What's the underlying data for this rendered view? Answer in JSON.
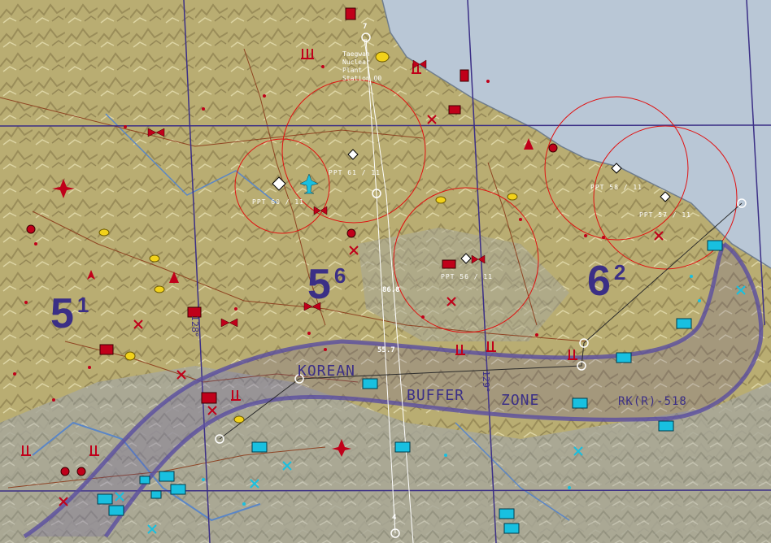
{
  "map": {
    "grid_labels": [
      {
        "main": "5",
        "sup": "1"
      },
      {
        "main": "5",
        "sup": "6"
      },
      {
        "main": "6",
        "sup": "2"
      }
    ],
    "longitude_labels": [
      "128°",
      "129°"
    ],
    "zone": {
      "word1": "KOREAN",
      "word2": "BUFFER",
      "word3": "ZONE",
      "id": "RK(R)-518"
    },
    "ppt_labels": [
      "PPT 60 / 11",
      "PPT 61 / 11",
      "PPT 58 / 11",
      "PPT 56 / 11",
      "PPT 57 / 11"
    ],
    "waypoints": {
      "top_number": "7",
      "bottom_number": "4"
    },
    "altitudes": [
      "86.8",
      "55.7"
    ],
    "target_label": "Taegwan\nNuclear\nPlant\nStation 00",
    "colors": {
      "terrain": "#b9ad72",
      "sea": "#b9c7d6",
      "grid_line": "#3b2f86",
      "threat_ring": "#e01010",
      "route": "#ffffff",
      "enemy": "#c0001a",
      "friendly": "#18c0e0",
      "buffer_zone": "#5a4ea0"
    },
    "icons": [
      "sam-site-icon",
      "aircraft-icon",
      "flak-icon",
      "radar-icon",
      "tank-icon",
      "airbase-icon"
    ]
  }
}
